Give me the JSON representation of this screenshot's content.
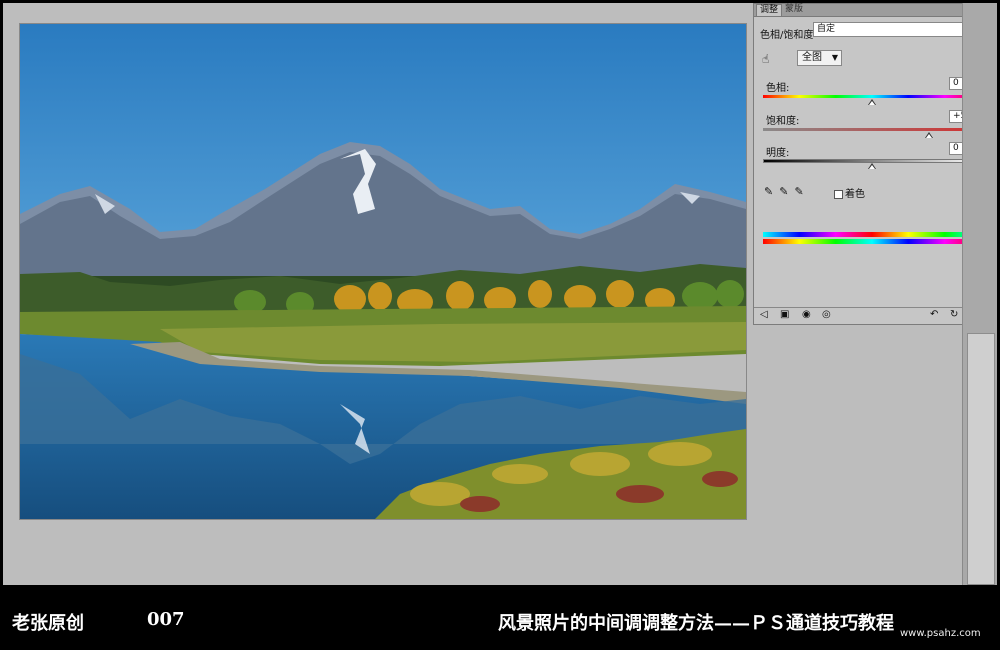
{
  "panel": {
    "tabs": [
      "调整",
      "蒙版"
    ],
    "tab_icons": "▸▸ ≡",
    "preset_label": "色相/饱和度",
    "preset_value": "自定",
    "range_value": "全图",
    "hue": {
      "label": "色相:",
      "value": "0",
      "level": 0.5
    },
    "saturation": {
      "label": "饱和度:",
      "value": "+52",
      "level": 0.76
    },
    "lightness": {
      "label": "明度:",
      "value": "0",
      "level": 0.5
    },
    "colorize_label": "着色"
  },
  "icons": [
    "hand-icon",
    "eyedropper-icon",
    "eyedropper-plus-icon",
    "eyedropper-minus-icon",
    "back-icon",
    "panel-icon",
    "mask-icon",
    "eye-icon",
    "refresh-icon",
    "reset-icon",
    "trash-icon"
  ],
  "caption": {
    "left": "老张原创",
    "number": "007",
    "title": "风景照片的中间调调整方法——ＰＳ通道技巧教程"
  },
  "watermark": "www.psahz.com",
  "colors": {
    "sky": "#2f7fc0",
    "water": "#1c5a8c",
    "panel": "#c6c6c6"
  }
}
